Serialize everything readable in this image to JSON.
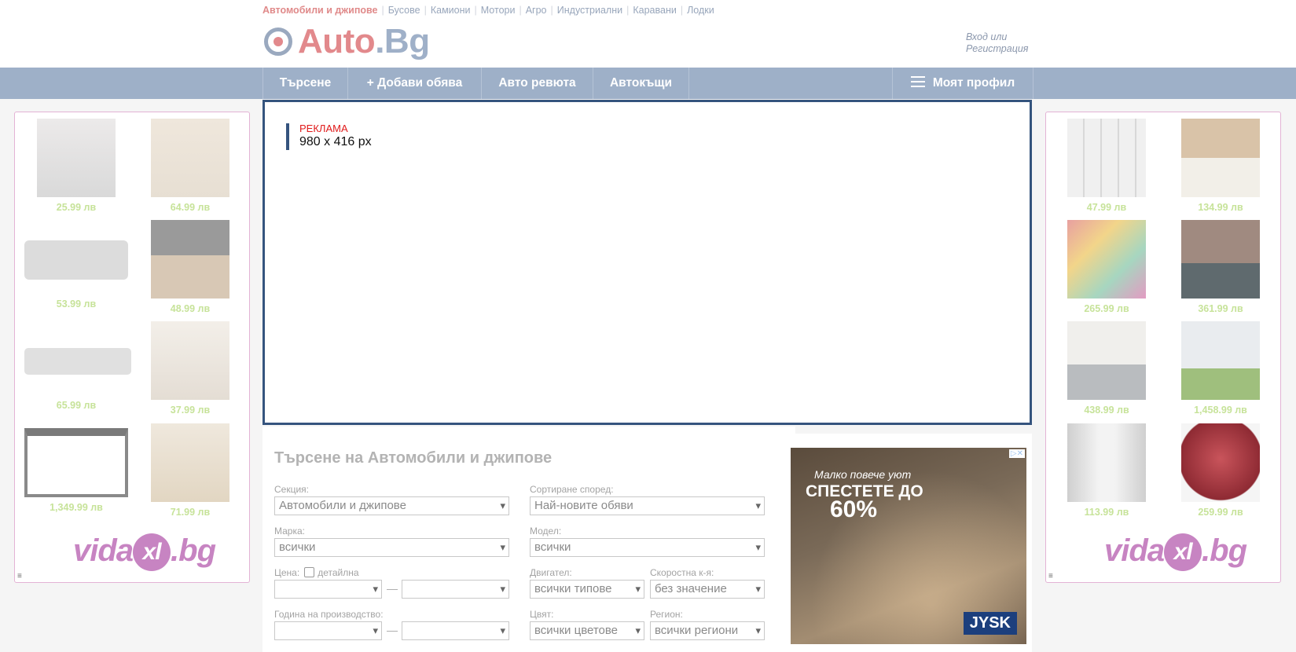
{
  "top_categories": [
    {
      "label": "Автомобили и джипове",
      "active": true
    },
    {
      "label": "Бусове"
    },
    {
      "label": "Камиони"
    },
    {
      "label": "Мотори"
    },
    {
      "label": "Агро"
    },
    {
      "label": "Индустриални"
    },
    {
      "label": "Каравани"
    },
    {
      "label": "Лодки"
    }
  ],
  "logo": {
    "part1": "Auto",
    "part2": ".Bg"
  },
  "auth": {
    "login": "Вход или",
    "register": "Регистрация"
  },
  "nav": {
    "search": "Търсене",
    "add": "+ Добави обява",
    "reviews": "Авто ревюта",
    "dealers": "Автокъщи",
    "profile": "Моят профил"
  },
  "ad": {
    "label": "РЕКЛАМА",
    "size": "980 x 416 px"
  },
  "left_products": [
    {
      "price": "25.99 лв"
    },
    {
      "price": "64.99 лв"
    },
    {
      "price": "53.99 лв"
    },
    {
      "price": "48.99 лв"
    },
    {
      "price": "65.99 лв"
    },
    {
      "price": "37.99 лв"
    },
    {
      "price": "1,349.99 лв"
    },
    {
      "price": "71.99 лв"
    }
  ],
  "right_products": [
    {
      "price": "47.99 лв"
    },
    {
      "price": "134.99 лв"
    },
    {
      "price": "265.99 лв"
    },
    {
      "price": "361.99 лв"
    },
    {
      "price": "438.99 лв"
    },
    {
      "price": "1,458.99 лв"
    },
    {
      "price": "113.99 лв"
    },
    {
      "price": "259.99 лв"
    }
  ],
  "vidaxl": {
    "part1": "vida",
    "part2": "xl",
    "part3": ".bg"
  },
  "search": {
    "title": "Търсене на Автомобили и джипове",
    "section_label": "Секция:",
    "section_value": "Автомобили и джипове",
    "sort_label": "Сортиране според:",
    "sort_value": "Най-новите обяви",
    "brand_label": "Марка:",
    "brand_value": "всички",
    "model_label": "Модел:",
    "model_value": "всички",
    "price_label": "Цена:",
    "price_detailed": "детайлна",
    "engine_label": "Двигател:",
    "engine_value": "всички типове",
    "gearbox_label": "Скоростна к-я:",
    "gearbox_value": "без значение",
    "year_label": "Година на производство:",
    "color_label": "Цвят:",
    "color_value": "всички цветове",
    "region_label": "Регион:",
    "region_value": "всички региони",
    "dash": "—"
  },
  "jysk_ad": {
    "line1": "Малко повече уют",
    "line2": "СПЕСТЕТЕ ДО",
    "line3": "60%",
    "brand": "JYSK",
    "adchoices": "▷✕"
  }
}
